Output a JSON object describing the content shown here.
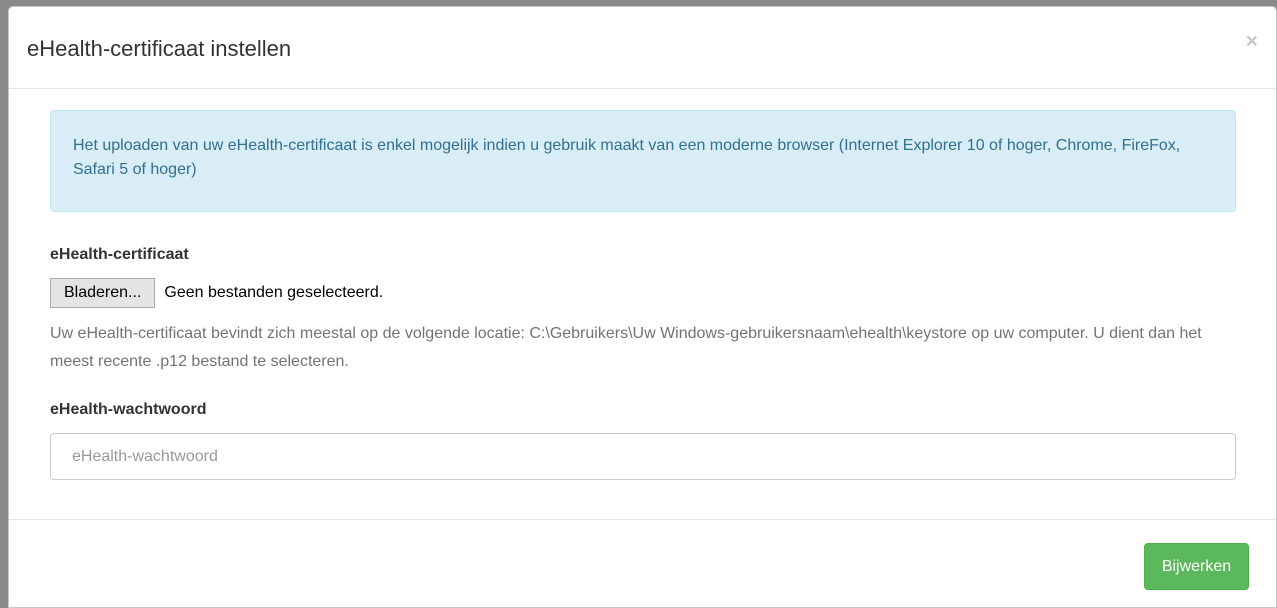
{
  "modal": {
    "title": "eHealth-certificaat instellen",
    "close_glyph": "×"
  },
  "alert": {
    "text": "Het uploaden van uw eHealth-certificaat is enkel mogelijk indien u gebruik maakt van een moderne browser (Internet Explorer 10 of hoger, Chrome, FireFox, Safari 5 of hoger)"
  },
  "certificate": {
    "label": "eHealth-certificaat",
    "browse_label": "Bladeren...",
    "file_status": "Geen bestanden geselecteerd.",
    "help": "Uw eHealth-certificaat bevindt zich meestal op de volgende locatie: C:\\Gebruikers\\Uw Windows-gebruikersnaam\\ehealth\\keystore op uw computer. U dient dan het meest recente .p12 bestand te selecteren."
  },
  "password": {
    "label": "eHealth-wachtwoord",
    "value": "",
    "placeholder": "eHealth-wachtwoord"
  },
  "footer": {
    "submit_label": "Bijwerken"
  },
  "colors": {
    "alert_bg": "#d9edf7",
    "alert_text": "#31708f",
    "submit_bg": "#5cb85c"
  }
}
